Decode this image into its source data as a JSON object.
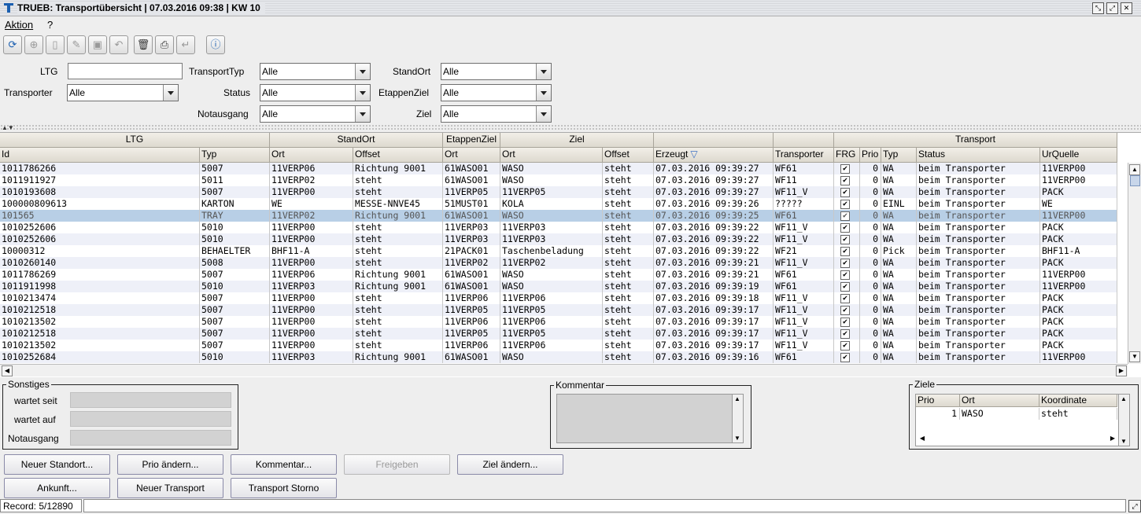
{
  "window": {
    "title": "TRUEB: Transportübersicht | 07.03.2016 09:38 | KW 10"
  },
  "menu": [
    {
      "label": "Aktion"
    },
    {
      "label": "?"
    }
  ],
  "filters": {
    "ltg_label": "LTG",
    "ltg_value": "",
    "transporter_label": "Transporter",
    "transporter_value": "Alle",
    "transporttyp_label": "TransportTyp",
    "transporttyp_value": "Alle",
    "status_label": "Status",
    "status_value": "Alle",
    "notausgang_label": "Notausgang",
    "notausgang_value": "Alle",
    "standort_label": "StandOrt",
    "standort_value": "Alle",
    "etappenziel_label": "EtappenZiel",
    "etappenziel_value": "Alle",
    "ziel_label": "Ziel",
    "ziel_value": "Alle"
  },
  "grid": {
    "groups": [
      {
        "label": "LTG"
      },
      {
        "label": "StandOrt"
      },
      {
        "label": "EtappenZiel"
      },
      {
        "label": "Ziel"
      },
      {
        "label": ""
      },
      {
        "label": ""
      },
      {
        "label": "Transport"
      }
    ],
    "columns": [
      {
        "label": "Id"
      },
      {
        "label": "Typ"
      },
      {
        "label": "Ort"
      },
      {
        "label": "Offset"
      },
      {
        "label": "Ort"
      },
      {
        "label": "Ort"
      },
      {
        "label": "Offset"
      },
      {
        "label": "Erzeugt"
      },
      {
        "label": "Transporter"
      },
      {
        "label": "FRG"
      },
      {
        "label": "Prio"
      },
      {
        "label": "Typ"
      },
      {
        "label": "Status"
      },
      {
        "label": "UrQuelle"
      }
    ],
    "sort_indicator": "▽",
    "rows": [
      [
        "1011786266",
        "5007",
        "11VERP06",
        "Richtung 9001",
        "61WASO01",
        "WASO",
        "steht",
        "07.03.2016 09:39:27",
        "WF61",
        true,
        "0",
        "WA",
        "beim Transporter",
        "11VERP00"
      ],
      [
        "1011911927",
        "5011",
        "11VERP02",
        "steht",
        "61WASO01",
        "WASO",
        "steht",
        "07.03.2016 09:39:27",
        "WF11",
        true,
        "0",
        "WA",
        "beim Transporter",
        "11VERP00"
      ],
      [
        "1010193608",
        "5007",
        "11VERP00",
        "steht",
        "11VERP05",
        "11VERP05",
        "steht",
        "07.03.2016 09:39:27",
        "WF11_V",
        true,
        "0",
        "WA",
        "beim Transporter",
        "PACK"
      ],
      [
        "100000809613",
        "KARTON",
        "WE",
        "MESSE-NNVE45",
        "51MUST01",
        "KOLA",
        "steht",
        "07.03.2016 09:39:26",
        "?????",
        true,
        "0",
        "EINL",
        "beim Transporter",
        "WE"
      ],
      [
        "101565",
        "TRAY",
        "11VERP02",
        "Richtung 9001",
        "61WASO01",
        "WASO",
        "steht",
        "07.03.2016 09:39:25",
        "WF61",
        true,
        "0",
        "WA",
        "beim Transporter",
        "11VERP00"
      ],
      [
        "1010252606",
        "5010",
        "11VERP00",
        "steht",
        "11VERP03",
        "11VERP03",
        "steht",
        "07.03.2016 09:39:22",
        "WF11_V",
        true,
        "0",
        "WA",
        "beim Transporter",
        "PACK"
      ],
      [
        "1010252606",
        "5010",
        "11VERP00",
        "steht",
        "11VERP03",
        "11VERP03",
        "steht",
        "07.03.2016 09:39:22",
        "WF11_V",
        true,
        "0",
        "WA",
        "beim Transporter",
        "PACK"
      ],
      [
        "10000312",
        "BEHAELTER",
        "BHF11-A",
        "steht",
        "21PACK01",
        "Taschenbeladung",
        "steht",
        "07.03.2016 09:39:22",
        "WF21",
        true,
        "0",
        "Pick",
        "beim Transporter",
        "BHF11-A"
      ],
      [
        "1010260140",
        "5008",
        "11VERP00",
        "steht",
        "11VERP02",
        "11VERP02",
        "steht",
        "07.03.2016 09:39:21",
        "WF11_V",
        true,
        "0",
        "WA",
        "beim Transporter",
        "PACK"
      ],
      [
        "1011786269",
        "5007",
        "11VERP06",
        "Richtung 9001",
        "61WASO01",
        "WASO",
        "steht",
        "07.03.2016 09:39:21",
        "WF61",
        true,
        "0",
        "WA",
        "beim Transporter",
        "11VERP00"
      ],
      [
        "1011911998",
        "5010",
        "11VERP03",
        "Richtung 9001",
        "61WASO01",
        "WASO",
        "steht",
        "07.03.2016 09:39:19",
        "WF61",
        true,
        "0",
        "WA",
        "beim Transporter",
        "11VERP00"
      ],
      [
        "1010213474",
        "5007",
        "11VERP00",
        "steht",
        "11VERP06",
        "11VERP06",
        "steht",
        "07.03.2016 09:39:18",
        "WF11_V",
        true,
        "0",
        "WA",
        "beim Transporter",
        "PACK"
      ],
      [
        "1010212518",
        "5007",
        "11VERP00",
        "steht",
        "11VERP05",
        "11VERP05",
        "steht",
        "07.03.2016 09:39:17",
        "WF11_V",
        true,
        "0",
        "WA",
        "beim Transporter",
        "PACK"
      ],
      [
        "1010213502",
        "5007",
        "11VERP00",
        "steht",
        "11VERP06",
        "11VERP06",
        "steht",
        "07.03.2016 09:39:17",
        "WF11_V",
        true,
        "0",
        "WA",
        "beim Transporter",
        "PACK"
      ],
      [
        "1010212518",
        "5007",
        "11VERP00",
        "steht",
        "11VERP05",
        "11VERP05",
        "steht",
        "07.03.2016 09:39:17",
        "WF11_V",
        true,
        "0",
        "WA",
        "beim Transporter",
        "PACK"
      ],
      [
        "1010213502",
        "5007",
        "11VERP00",
        "steht",
        "11VERP06",
        "11VERP06",
        "steht",
        "07.03.2016 09:39:17",
        "WF11_V",
        true,
        "0",
        "WA",
        "beim Transporter",
        "PACK"
      ],
      [
        "1010252684",
        "5010",
        "11VERP03",
        "Richtung 9001",
        "61WASO01",
        "WASO",
        "steht",
        "07.03.2016 09:39:16",
        "WF61",
        true,
        "0",
        "WA",
        "beim Transporter",
        "11VERP00"
      ]
    ],
    "selected_row": 4
  },
  "sonstiges": {
    "legend": "Sonstiges",
    "wartet_seit_label": "wartet seit",
    "wartet_seit_value": "",
    "wartet_auf_label": "wartet auf",
    "wartet_auf_value": "",
    "notausgang_label": "Notausgang",
    "notausgang_value": ""
  },
  "kommentar": {
    "legend": "Kommentar",
    "value": ""
  },
  "ziele": {
    "legend": "Ziele",
    "columns": [
      {
        "label": "Prio"
      },
      {
        "label": "Ort"
      },
      {
        "label": "Koordinate"
      }
    ],
    "rows": [
      [
        "1",
        "WASO",
        "steht"
      ]
    ]
  },
  "buttons": {
    "neuer_standort": "Neuer Standort...",
    "prio_aendern": "Prio ändern...",
    "kommentar": "Kommentar...",
    "freigeben": "Freigeben",
    "ziel_aendern": "Ziel ändern...",
    "ankunft": "Ankunft...",
    "neuer_transport": "Neuer Transport",
    "transport_storno": "Transport Storno"
  },
  "status": {
    "record_label": "Record: 5/12890",
    "field_value": ""
  },
  "colors": {
    "selected_row": "#b8cfe6",
    "row_even": "#eef0f8",
    "row_odd": "#ffffff",
    "accent": "#1b5fb0"
  }
}
